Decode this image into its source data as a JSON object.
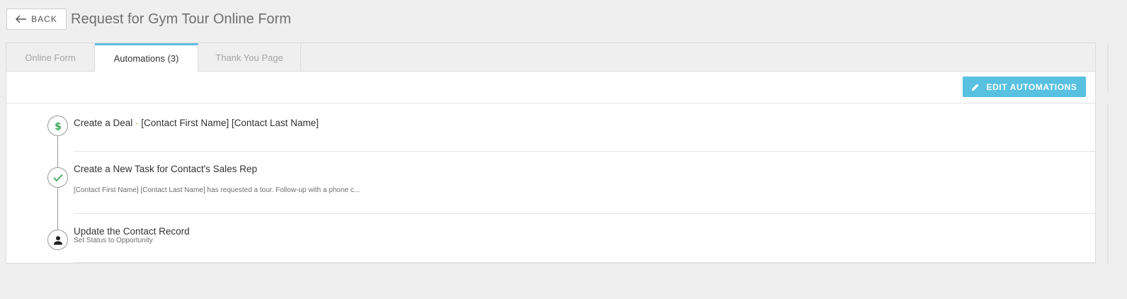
{
  "header": {
    "back_label": "BACK",
    "title": "Request for Gym Tour Online Form"
  },
  "tabs": [
    {
      "label": "Online Form",
      "active": false
    },
    {
      "label": "Automations (3)",
      "active": true
    },
    {
      "label": "Thank You Page",
      "active": false
    }
  ],
  "toolbar": {
    "edit_label": "EDIT AUTOMATIONS"
  },
  "automations": [
    {
      "icon": "dollar-icon",
      "title_prefix": "Create a Deal",
      "title_sep": " - ",
      "title_suffix": "[Contact First Name] [Contact Last Name]"
    },
    {
      "icon": "check-icon",
      "title": "Create a New Task for Contact's Sales Rep",
      "subtitle": "[Contact First Name] [Contact Last Name] has requested a tour. Follow-up with a phone c..."
    },
    {
      "icon": "person-icon",
      "title": "Update the Contact Record",
      "subtitle": "Set Status to Opportunity"
    }
  ],
  "colors": {
    "accent": "#5bc0de",
    "button": "#58c1e1",
    "success": "#3aa75b",
    "deal_separator": "#e8a33d"
  }
}
